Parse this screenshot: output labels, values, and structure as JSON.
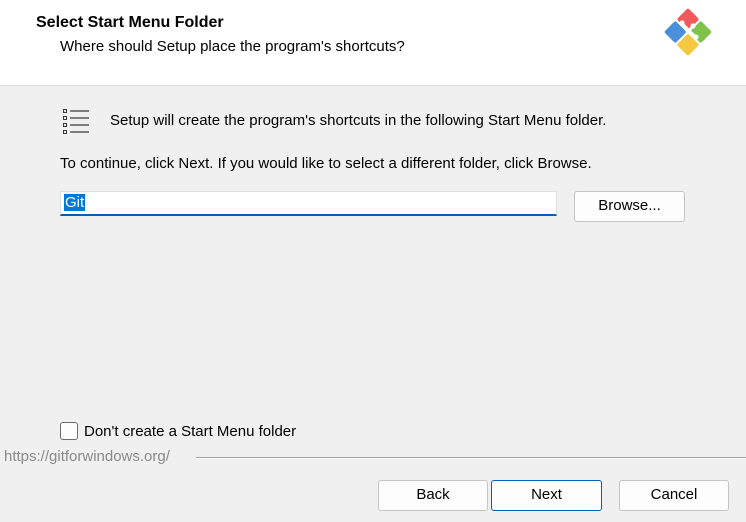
{
  "header": {
    "title": "Select Start Menu Folder",
    "subtitle": "Where should Setup place the program's shortcuts?",
    "logo_icon": "git-logo-icon"
  },
  "content": {
    "icon": "list-icon",
    "intro": "Setup will create the program's shortcuts in the following Start Menu folder.",
    "instruction": "To continue, click Next. If you would like to select a different folder, click Browse.",
    "folder_value": "Git",
    "browse_label": "Browse...",
    "no_folder_checkbox": {
      "label": "Don't create a Start Menu folder",
      "checked": false
    }
  },
  "footer": {
    "link": "https://gitforwindows.org/",
    "back_label": "Back",
    "next_label": "Next",
    "cancel_label": "Cancel"
  },
  "colors": {
    "accent": "#005fb8",
    "selection": "#0078d7",
    "background": "#f0f0f0"
  }
}
